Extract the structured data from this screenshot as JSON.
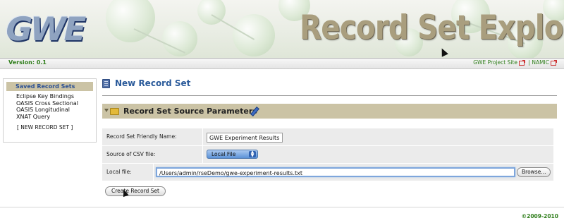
{
  "header": {
    "logo_text": "GWE",
    "title": "Record Set Explorer",
    "version": "Version: 0.1",
    "links": [
      {
        "label": "GWE Project Site"
      },
      {
        "label": "NAMIC"
      }
    ],
    "separator": "|"
  },
  "sidebar": {
    "heading": "Saved Record Sets",
    "items": [
      {
        "label": "Eclipse Key Bindings"
      },
      {
        "label": "OASIS Cross Sectional"
      },
      {
        "label": "OASIS Longitudinal"
      },
      {
        "label": "XNAT Query"
      }
    ],
    "new_link": "[ NEW RECORD SET ]"
  },
  "main": {
    "page_title": "New Record Set",
    "section_title": "Record Set Source Parameters",
    "form": {
      "friendly_name": {
        "label": "Record Set Friendly Name:",
        "value": "GWE Experiment Results"
      },
      "csv_source": {
        "label": "Source of CSV file:",
        "selected": "Local File"
      },
      "local_file": {
        "label": "Local file:",
        "value": "/Users/admin/rseDemo/gwe-experiment-results.txt",
        "browse_label": "Browse..."
      }
    },
    "create_button": "Create Record Set"
  },
  "footer": {
    "copyright": "©2009-2010"
  },
  "colors": {
    "section_bar": "#cbc3a5",
    "link_green": "#2e7d1a",
    "title_blue": "#2a5a9a"
  }
}
